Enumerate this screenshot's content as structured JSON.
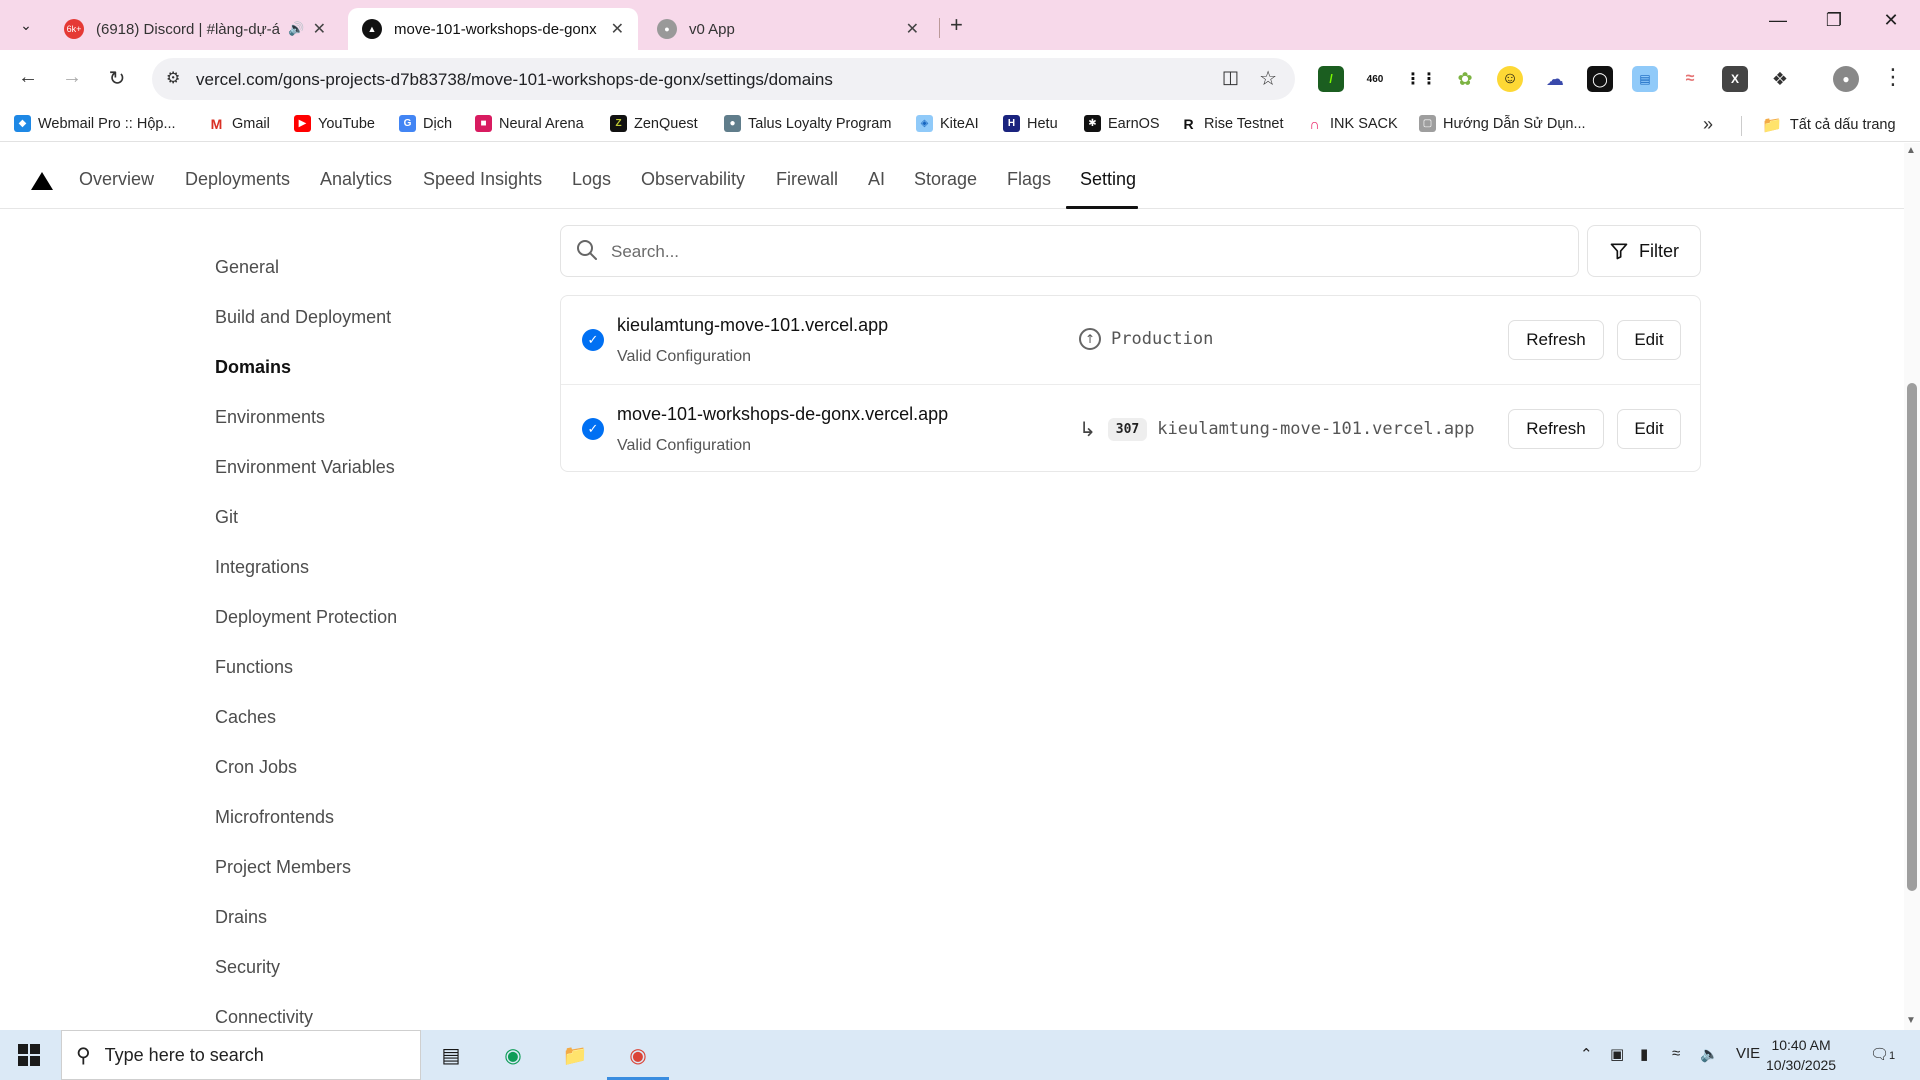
{
  "browser": {
    "tabs": [
      {
        "title": "(6918) Discord | #làng-dự-á",
        "badge": "6k+",
        "icon": "discord-icon",
        "active": false
      },
      {
        "title": "move-101-workshops-de-gonx",
        "icon": "vercel-icon",
        "active": true
      },
      {
        "title": "v0 App",
        "icon": "globe-icon",
        "active": false
      }
    ],
    "url": "vercel.com/gons-projects-d7b83738/move-101-workshops-de-gonx/settings/domains",
    "extensions": [
      {
        "name": "terminal-ext-icon",
        "label": "/"
      },
      {
        "name": "counter-ext-icon",
        "label": "460"
      },
      {
        "name": "dots-ext-icon",
        "label": ""
      },
      {
        "name": "leaf-ext-icon",
        "label": ""
      },
      {
        "name": "smiley-ext-icon",
        "label": ""
      },
      {
        "name": "cloud-ext-icon",
        "label": ""
      },
      {
        "name": "ring-ext-icon",
        "label": ""
      },
      {
        "name": "card-ext-icon",
        "label": ""
      },
      {
        "name": "wave-ext-icon",
        "label": ""
      },
      {
        "name": "x-ext-icon",
        "label": "X"
      },
      {
        "name": "puzzle-icon",
        "label": ""
      }
    ],
    "bookmarks": [
      "Webmail Pro :: Hộp...",
      "Gmail",
      "YouTube",
      "Dịch",
      "Neural Arena",
      "ZenQuest",
      "Talus Loyalty Program",
      "KiteAI",
      "Hetu",
      "EarnOS",
      "Rise Testnet",
      "INK SACK",
      "Hướng Dẫn Sử Dụn..."
    ],
    "all_bookmarks": "Tất cả dấu trang"
  },
  "topnav": {
    "items": [
      "Overview",
      "Deployments",
      "Analytics",
      "Speed Insights",
      "Logs",
      "Observability",
      "Firewall",
      "AI",
      "Storage",
      "Flags",
      "Setting"
    ],
    "active": "Setting"
  },
  "sidebar": {
    "items": [
      "General",
      "Build and Deployment",
      "Domains",
      "Environments",
      "Environment Variables",
      "Git",
      "Integrations",
      "Deployment Protection",
      "Functions",
      "Caches",
      "Cron Jobs",
      "Microfrontends",
      "Project Members",
      "Drains",
      "Security",
      "Connectivity"
    ],
    "active": "Domains"
  },
  "search": {
    "placeholder": "Search..."
  },
  "filter": {
    "label": "Filter"
  },
  "domains": [
    {
      "name": "kieulamtung-move-101.vercel.app",
      "status": "Valid Configuration",
      "target": "Production",
      "refresh": "Refresh",
      "edit": "Edit"
    },
    {
      "name": "move-101-workshops-de-gonx.vercel.app",
      "status": "Valid Configuration",
      "redirect_code": "307",
      "target": "kieulamtung-move-101.vercel.app",
      "refresh": "Refresh",
      "edit": "Edit"
    }
  ],
  "taskbar": {
    "search_placeholder": "Type here to search",
    "language": "VIE",
    "time": "10:40 AM",
    "date": "10/30/2025",
    "notifications": "1"
  },
  "colors": {
    "accent": "#0070f3",
    "tabstrip": "#f7d9ea",
    "taskbar": "#dbe9f6"
  }
}
